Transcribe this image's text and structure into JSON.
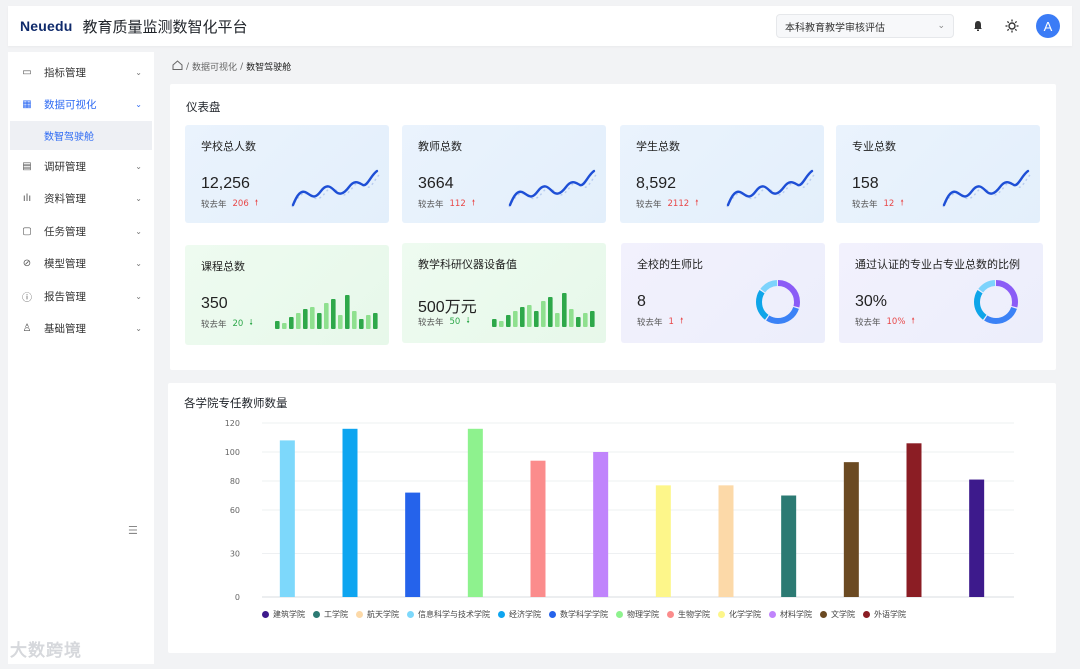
{
  "header": {
    "logo": "Neuedu",
    "title": "教育质量监测数智化平台",
    "select_value": "本科教育教学审核评估",
    "avatar_letter": "A"
  },
  "sidebar": {
    "items": [
      {
        "label": "指标管理",
        "icon": "monitor-icon",
        "glyph": "▭"
      },
      {
        "label": "数据可视化",
        "icon": "grid-icon",
        "glyph": "▦",
        "active": true
      },
      {
        "label": "调研管理",
        "icon": "form-icon",
        "glyph": "▤"
      },
      {
        "label": "资料管理",
        "icon": "bar-chart-icon",
        "glyph": "ılı"
      },
      {
        "label": "任务管理",
        "icon": "document-icon",
        "glyph": "▢"
      },
      {
        "label": "模型管理",
        "icon": "check-circle-icon",
        "glyph": "⊘"
      },
      {
        "label": "报告管理",
        "icon": "alert-circle-icon",
        "glyph": "ⓘ"
      },
      {
        "label": "基础管理",
        "icon": "user-icon",
        "glyph": "♙"
      }
    ],
    "submenu_label": "数智驾驶舱"
  },
  "watermark": "大数跨境",
  "breadcrumb": {
    "home_icon": "home-icon",
    "item1": "数据可视化",
    "sep": "/",
    "current": "数智驾驶舱"
  },
  "dashboard": {
    "title": "仪表盘",
    "compare_label": "较去年",
    "cards": [
      {
        "title": "学校总人数",
        "value": "12,256",
        "delta": "206",
        "dir": "up",
        "theme": "blue",
        "chart": "wave"
      },
      {
        "title": "教师总数",
        "value": "3664",
        "delta": "112",
        "dir": "up",
        "theme": "blue",
        "chart": "wave"
      },
      {
        "title": "学生总数",
        "value": "8,592",
        "delta": "2112",
        "dir": "up",
        "theme": "blue",
        "chart": "wave"
      },
      {
        "title": "专业总数",
        "value": "158",
        "delta": "12",
        "dir": "up",
        "theme": "blue",
        "chart": "wave"
      },
      {
        "title": "课程总数",
        "value": "350",
        "delta": "20",
        "dir": "down",
        "theme": "green",
        "chart": "bars"
      },
      {
        "title": "教学科研仪器设备值",
        "value": "500万元",
        "delta": "50",
        "dir": "down",
        "theme": "green",
        "chart": "bars"
      },
      {
        "title": "全校的生师比",
        "value": "8",
        "delta": "1",
        "dir": "up",
        "theme": "purple",
        "chart": "donut"
      },
      {
        "title": "通过认证的专业占专业总数的比例",
        "value": "30%",
        "delta": "10%",
        "dir": "up",
        "theme": "purple",
        "chart": "donut"
      }
    ]
  },
  "chart_section": {
    "title": "各学院专任教师数量"
  },
  "chart_data": {
    "type": "bar",
    "title": "各学院专任教师数量",
    "ylim": [
      0,
      120
    ],
    "yticks": [
      0,
      30,
      60,
      80,
      100,
      120
    ],
    "grid": true,
    "legend_position": "bottom",
    "series": [
      {
        "name": "建筑学院",
        "value": 108,
        "color": "#7dd8fb",
        "legend_color": "#3d1a8c"
      },
      {
        "name": "工学院",
        "value": 116,
        "color": "#0ea5f0",
        "legend_color": "#2c7a73"
      },
      {
        "name": "航天学院",
        "value": 72,
        "color": "#2563eb",
        "legend_color": "#fcd9a8"
      },
      {
        "name": "信息科学与技术学院",
        "value": 116,
        "color": "#8ef28e",
        "legend_color": "#7dd8fb"
      },
      {
        "name": "经济学院",
        "value": 94,
        "color": "#fb8c8c",
        "legend_color": "#0ea5f0"
      },
      {
        "name": "数学科学学院",
        "value": 100,
        "color": "#c084fc",
        "legend_color": "#2563eb"
      },
      {
        "name": "物理学院",
        "value": 77,
        "color": "#fdf68a",
        "legend_color": "#8ef28e"
      },
      {
        "name": "生物学院",
        "value": 77,
        "color": "#fcd9a8",
        "legend_color": "#fb8c8c"
      },
      {
        "name": "化学学院",
        "value": 70,
        "color": "#2c7a73",
        "legend_color": "#fdf68a"
      },
      {
        "name": "材料学院",
        "value": 93,
        "color": "#6b4a22",
        "legend_color": "#c084fc"
      },
      {
        "name": "文学院",
        "value": 106,
        "color": "#8b1d24",
        "legend_color": "#6b4a22"
      },
      {
        "name": "外语学院",
        "value": 81,
        "color": "#3d1a8c",
        "legend_color": "#8b1d24"
      }
    ]
  }
}
